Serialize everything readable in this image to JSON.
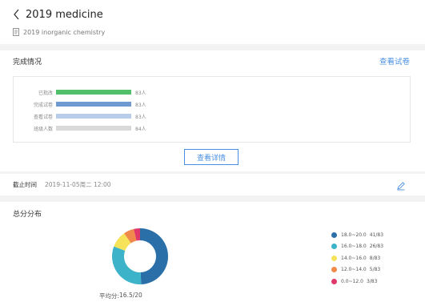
{
  "header": {
    "title": "2019 medicine",
    "subtitle": "2019 inorganic chemistry"
  },
  "completion": {
    "section_title": "完成情况",
    "view_paper_link": "查看试卷",
    "bars": [
      {
        "label": "已批改",
        "value_text": "83人",
        "fill": 1.0,
        "color": "#52c06a"
      },
      {
        "label": "完成试卷",
        "value_text": "83人",
        "fill": 1.0,
        "color": "#6f9ad1"
      },
      {
        "label": "查看试卷",
        "value_text": "83人",
        "fill": 1.0,
        "color": "#b7cde9"
      },
      {
        "label": "班级人数",
        "value_text": "84人",
        "fill": 1.0,
        "color": "#d9d9d9"
      }
    ],
    "detail_button": "查看详情"
  },
  "deadline": {
    "label": "截止时间",
    "value": "2019-11-05周二 12:00"
  },
  "score_distribution": {
    "section_title": "总分分布",
    "average_label": "平均分:",
    "average_value": "16.5/20"
  },
  "chart_data": {
    "type": "pie",
    "donut": true,
    "total": 83,
    "slices": [
      {
        "range": "18.0~20.0",
        "count_text": "41/83",
        "value": 41,
        "color": "#2a6fa8"
      },
      {
        "range": "16.0~18.0",
        "count_text": "26/83",
        "value": 26,
        "color": "#3db3c9"
      },
      {
        "range": "14.0~16.0",
        "count_text": "8/83",
        "value": 8,
        "color": "#f7e35a"
      },
      {
        "range": "12.0~14.0",
        "count_text": "5/83",
        "value": 5,
        "color": "#f08a4b"
      },
      {
        "range": "0.0~12.0",
        "count_text": "3/83",
        "value": 3,
        "color": "#e0386a"
      }
    ],
    "legend_position": "right"
  }
}
